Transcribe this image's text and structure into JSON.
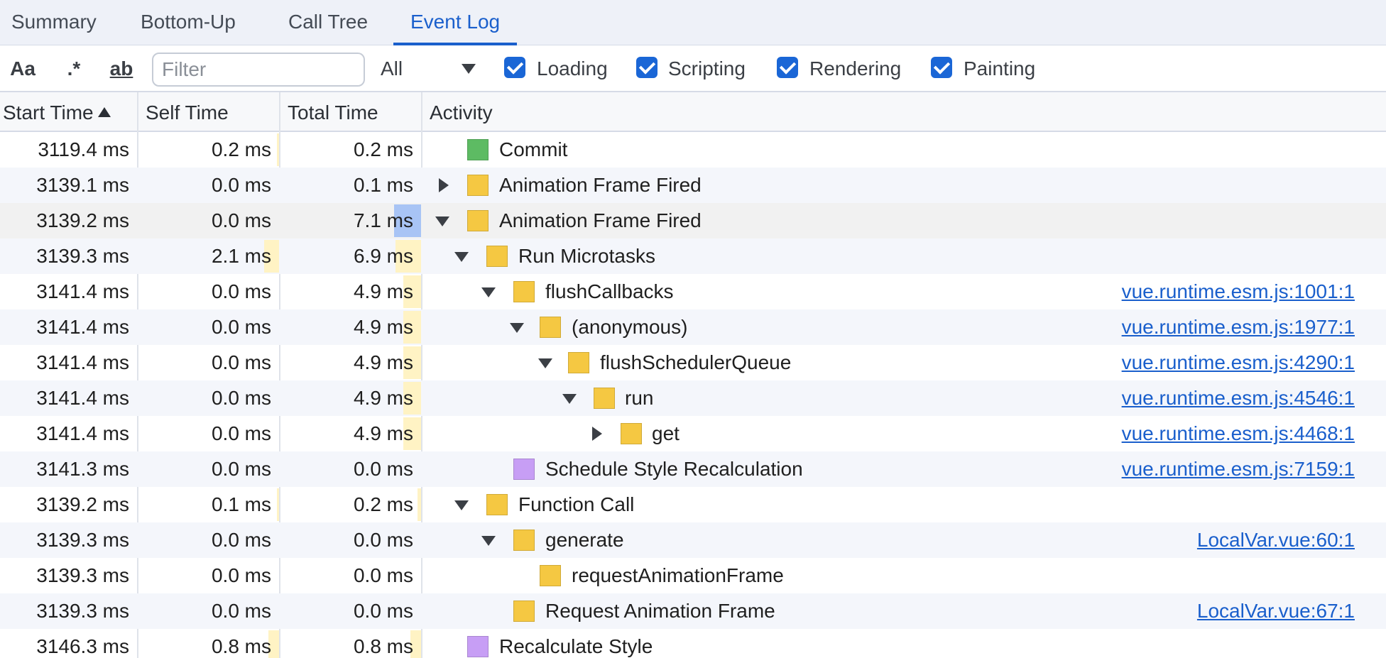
{
  "tabs": [
    {
      "label": "Summary",
      "active": false
    },
    {
      "label": "Bottom-Up",
      "active": false
    },
    {
      "label": "Call Tree",
      "active": false
    },
    {
      "label": "Event Log",
      "active": true
    }
  ],
  "toolbar": {
    "match_case_label": "Aa",
    "regex_label": ".*",
    "whole_word_label": "ab",
    "filter_placeholder": "Filter",
    "select_value": "All",
    "checkboxes": [
      {
        "label": "Loading",
        "checked": true
      },
      {
        "label": "Scripting",
        "checked": true
      },
      {
        "label": "Rendering",
        "checked": true
      },
      {
        "label": "Painting",
        "checked": true
      }
    ]
  },
  "columns": {
    "start": "Start Time",
    "self": "Self Time",
    "total": "Total Time",
    "activity": "Activity"
  },
  "colors": {
    "scripting": "#f5c842",
    "rendering": "#c79ef5",
    "painting": "#5dbb63",
    "link": "#1a5fcc",
    "accent": "#1a66d6"
  },
  "rows": [
    {
      "start": "3119.4 ms",
      "self": "0.2 ms",
      "total": "0.2 ms",
      "activity": "Commit",
      "category": "painting",
      "toggle": "none",
      "link": ""
    },
    {
      "start": "3139.1 ms",
      "self": "0.0 ms",
      "total": "0.1 ms",
      "activity": "Animation Frame Fired",
      "category": "scripting",
      "toggle": "right",
      "link": ""
    },
    {
      "start": "3139.2 ms",
      "self": "0.0 ms",
      "total": "7.1 ms",
      "activity": "Animation Frame Fired",
      "category": "scripting",
      "toggle": "down",
      "link": ""
    },
    {
      "start": "3139.3 ms",
      "self": "2.1 ms",
      "total": "6.9 ms",
      "activity": "Run Microtasks",
      "category": "scripting",
      "toggle": "down",
      "link": ""
    },
    {
      "start": "3141.4 ms",
      "self": "0.0 ms",
      "total": "4.9 ms",
      "activity": "flushCallbacks",
      "category": "scripting",
      "toggle": "down",
      "link": "vue.runtime.esm.js:1001:1"
    },
    {
      "start": "3141.4 ms",
      "self": "0.0 ms",
      "total": "4.9 ms",
      "activity": "(anonymous)",
      "category": "scripting",
      "toggle": "down",
      "link": "vue.runtime.esm.js:1977:1"
    },
    {
      "start": "3141.4 ms",
      "self": "0.0 ms",
      "total": "4.9 ms",
      "activity": "flushSchedulerQueue",
      "category": "scripting",
      "toggle": "down",
      "link": "vue.runtime.esm.js:4290:1"
    },
    {
      "start": "3141.4 ms",
      "self": "0.0 ms",
      "total": "4.9 ms",
      "activity": "run",
      "category": "scripting",
      "toggle": "down",
      "link": "vue.runtime.esm.js:4546:1"
    },
    {
      "start": "3141.4 ms",
      "self": "0.0 ms",
      "total": "4.9 ms",
      "activity": "get",
      "category": "scripting",
      "toggle": "right",
      "link": "vue.runtime.esm.js:4468:1"
    },
    {
      "start": "3141.3 ms",
      "self": "0.0 ms",
      "total": "0.0 ms",
      "activity": "Schedule Style Recalculation",
      "category": "rendering",
      "toggle": "none",
      "link": "vue.runtime.esm.js:7159:1"
    },
    {
      "start": "3139.2 ms",
      "self": "0.1 ms",
      "total": "0.2 ms",
      "activity": "Function Call",
      "category": "scripting",
      "toggle": "down",
      "link": ""
    },
    {
      "start": "3139.3 ms",
      "self": "0.0 ms",
      "total": "0.0 ms",
      "activity": "generate",
      "category": "scripting",
      "toggle": "down",
      "link": "LocalVar.vue:60:1"
    },
    {
      "start": "3139.3 ms",
      "self": "0.0 ms",
      "total": "0.0 ms",
      "activity": "requestAnimationFrame",
      "category": "scripting",
      "toggle": "none",
      "link": ""
    },
    {
      "start": "3139.3 ms",
      "self": "0.0 ms",
      "total": "0.0 ms",
      "activity": "Request Animation Frame",
      "category": "scripting",
      "toggle": "none",
      "link": "LocalVar.vue:67:1"
    },
    {
      "start": "3146.3 ms",
      "self": "0.8 ms",
      "total": "0.8 ms",
      "activity": "Recalculate Style",
      "category": "rendering",
      "toggle": "none",
      "link": ""
    }
  ]
}
